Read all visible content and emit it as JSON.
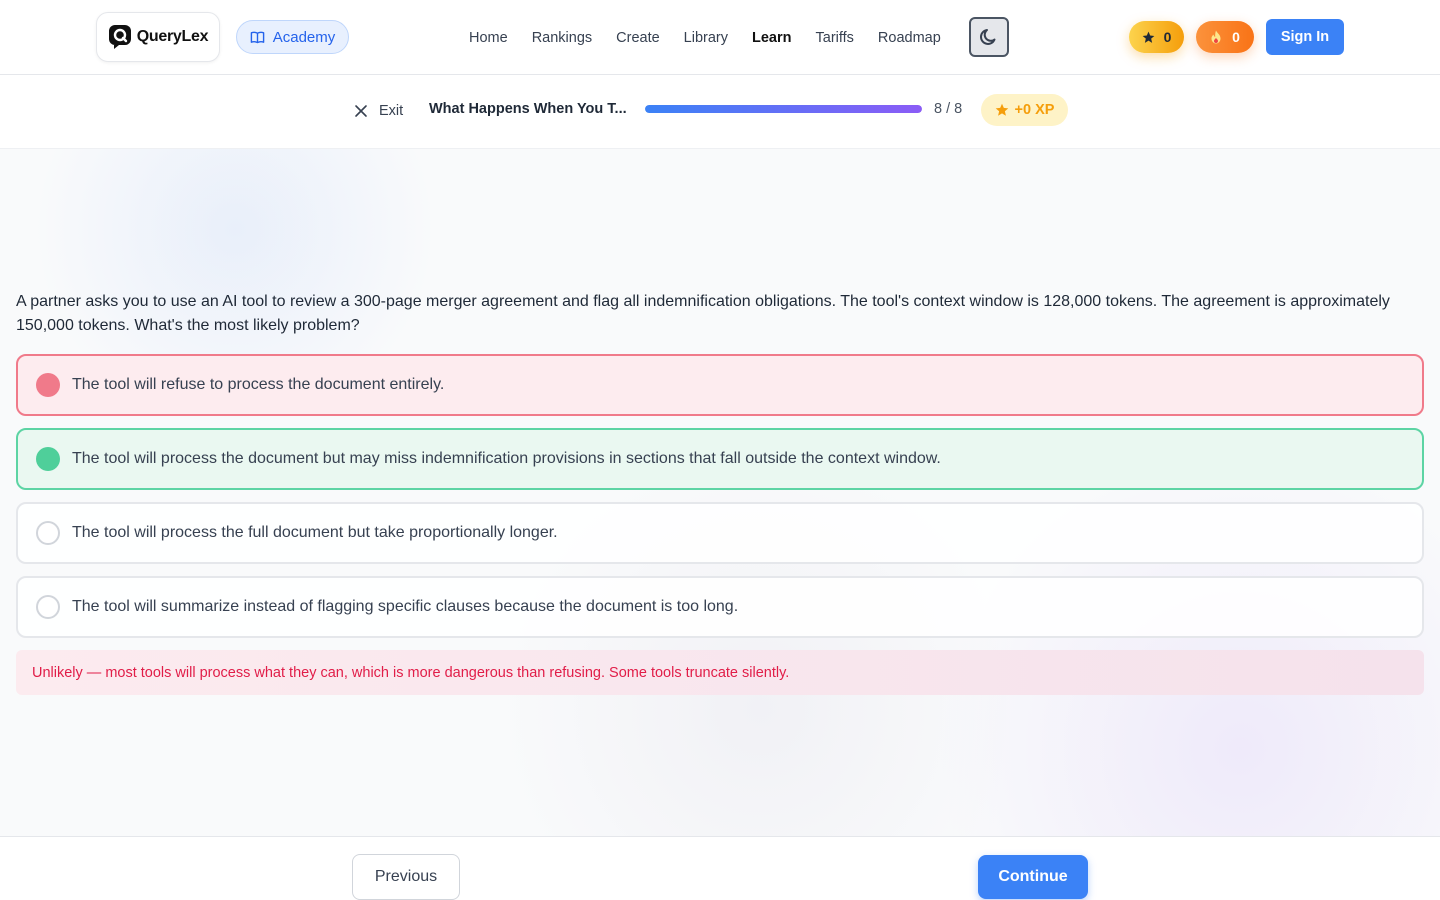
{
  "header": {
    "logo_text": "QueryLex",
    "academy_label": "Academy",
    "nav": [
      {
        "label": "Home",
        "active": false
      },
      {
        "label": "Rankings",
        "active": false
      },
      {
        "label": "Create",
        "active": false
      },
      {
        "label": "Library",
        "active": false
      },
      {
        "label": "Learn",
        "active": true
      },
      {
        "label": "Tariffs",
        "active": false
      },
      {
        "label": "Roadmap",
        "active": false
      }
    ],
    "theme_icon": "moon-icon",
    "stars_count": "0",
    "streak_count": "0",
    "signin_label": "Sign In"
  },
  "lesson": {
    "exit_label": "Exit",
    "title": "What Happens When You T...",
    "progress_fraction": 1.0,
    "count": "8 / 8",
    "xp_label": "+0 XP"
  },
  "quiz": {
    "question": "A partner asks you to use an AI tool to review a 300-page merger agreement and flag all indemnification obligations. The tool's context window is 128,000 tokens. The agreement is approximately 150,000 tokens. What's the most likely problem?",
    "options": [
      {
        "text": "The tool will refuse to process the document entirely.",
        "state": "wrong"
      },
      {
        "text": "The tool will process the document but may miss indemnification provisions in sections that fall outside the context window.",
        "state": "correct"
      },
      {
        "text": "The tool will process the full document but take proportionally longer.",
        "state": "neutral"
      },
      {
        "text": "The tool will summarize instead of flagging specific clauses because the document is too long.",
        "state": "neutral"
      }
    ],
    "feedback": "Unlikely — most tools will process what they can, which is more dangerous than refusing. Some tools truncate silently."
  },
  "footer": {
    "previous_label": "Previous",
    "continue_label": "Continue"
  },
  "colors": {
    "accent": "#3b82f6",
    "wrong": "#f07a8a",
    "correct": "#4fcf9a",
    "feedback_text": "#e11d48"
  }
}
